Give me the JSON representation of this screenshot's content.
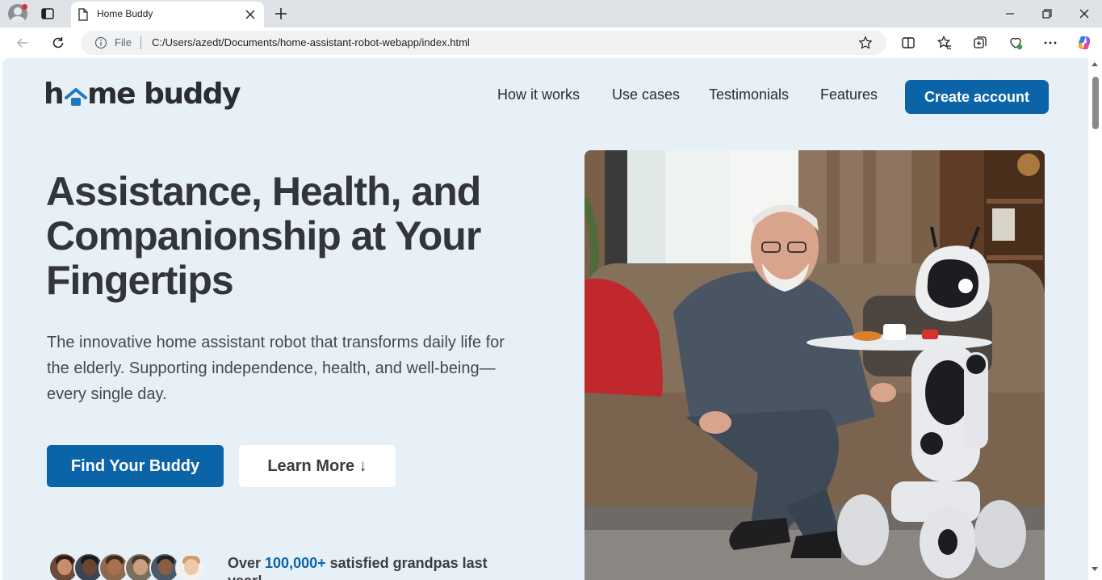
{
  "browser": {
    "tab_title": "Home Buddy",
    "address_scheme": "File",
    "address_url": "C:/Users/azedt/Documents/home-assistant-robot-webapp/index.html"
  },
  "header": {
    "logo_text_left": "h",
    "logo_text_right": "me buddy",
    "nav": [
      "How it works",
      "Use cases",
      "Testimonials",
      "Features"
    ],
    "cta_label": "Create account"
  },
  "hero": {
    "headline": "Assistance, Health, and Companionship at Your Fingertips",
    "subtext": "The innovative home assistant robot that transforms daily life for the elderly. Supporting independence, health, and well-being—every single day.",
    "primary_button": "Find Your Buddy",
    "secondary_button": "Learn More ↓",
    "social_proof_prefix": "Over ",
    "social_proof_highlight": "100,000+",
    "social_proof_suffix": " satisfied grandpas last year!"
  },
  "colors": {
    "brand_blue": "#0b64a8",
    "page_background": "#e6f0f6",
    "heading_text": "#33353a"
  },
  "icons": [
    "profile-icon",
    "tab-actions-icon",
    "page-icon",
    "close-icon",
    "plus-icon",
    "back-icon",
    "refresh-icon",
    "info-icon",
    "star-icon",
    "split-screen-icon",
    "favorites-icon",
    "collections-icon",
    "browser-essentials-icon",
    "more-icon",
    "copilot-icon",
    "minimize-icon",
    "maximize-icon",
    "house-roof-icon"
  ]
}
